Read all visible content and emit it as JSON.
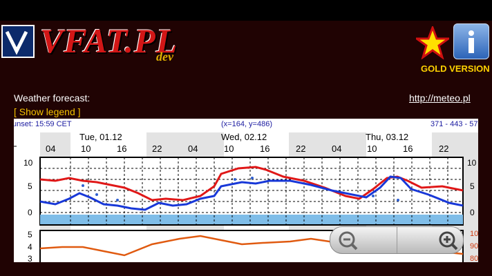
{
  "app": {
    "logo_text": "VFAT.PL",
    "logo_sub": "dev",
    "gold_version": "GOLD VERSION",
    "weather_forecast": "Weather forecast:",
    "meteo_link": "http://meteo.pl",
    "show_legend": "[ Show legend ]"
  },
  "forecast": {
    "sunset": "unset: 15:59 CET",
    "coords": "(x=164, y=486)",
    "grid_ref": "371 - 443 - 57",
    "days": [
      "Tue, 01.12",
      "Wed, 02.12",
      "Thu, 03.12"
    ],
    "hours": [
      "04",
      "10",
      "16",
      "22",
      "04",
      "10",
      "16",
      "22",
      "04",
      "10",
      "16",
      "22"
    ],
    "y_labels_top": [
      "10",
      "5",
      "0"
    ],
    "y_labels_right": [
      "10",
      "5",
      "0"
    ],
    "y_labels_bottom": [
      "5",
      "4",
      "3"
    ],
    "y_labels_bottom_right": [
      "10",
      "90",
      "80"
    ]
  },
  "colors": {
    "accent_gold": "#ffd200",
    "logo_red": "#d21616"
  },
  "icons": [
    "logo-v-icon",
    "star-icon",
    "info-icon",
    "zoom-out-icon",
    "zoom-in-icon"
  ]
}
